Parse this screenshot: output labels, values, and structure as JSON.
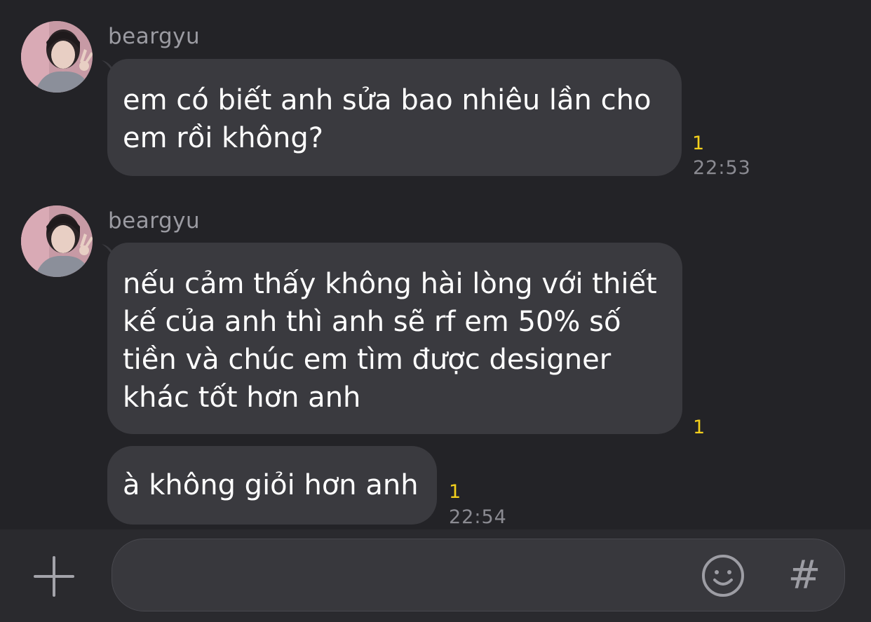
{
  "messages": [
    {
      "sender": "beargyu",
      "avatar_icon": "profile-photo-avatar",
      "text_lines": [
        "em có biết anh sửa bao nhiêu lần cho",
        "em rồi không?"
      ],
      "unread_count": "1",
      "time": "22:53"
    },
    {
      "sender": "beargyu",
      "avatar_icon": "profile-photo-avatar",
      "text_lines": [
        "nếu cảm thấy không hài lòng với thiết",
        "kế của anh thì anh sẽ rf em 50% số",
        "tiền và chúc em tìm được designer",
        "khác tốt hơn anh"
      ],
      "unread_count": "1",
      "time": ""
    },
    {
      "sender": "",
      "text_lines": [
        "à không giỏi hơn anh"
      ],
      "unread_count": "1",
      "time": "22:54"
    }
  ],
  "composer": {
    "plus_icon": "plus-icon",
    "input_value": "",
    "input_placeholder": "",
    "emoji_icon": "emoji-icon",
    "hash_label": "#"
  },
  "colors": {
    "background": "#232327",
    "bubble": "#3a3a3f",
    "unread": "#f4d01c",
    "time": "#8b8b92",
    "sender": "#9b9ba2"
  }
}
